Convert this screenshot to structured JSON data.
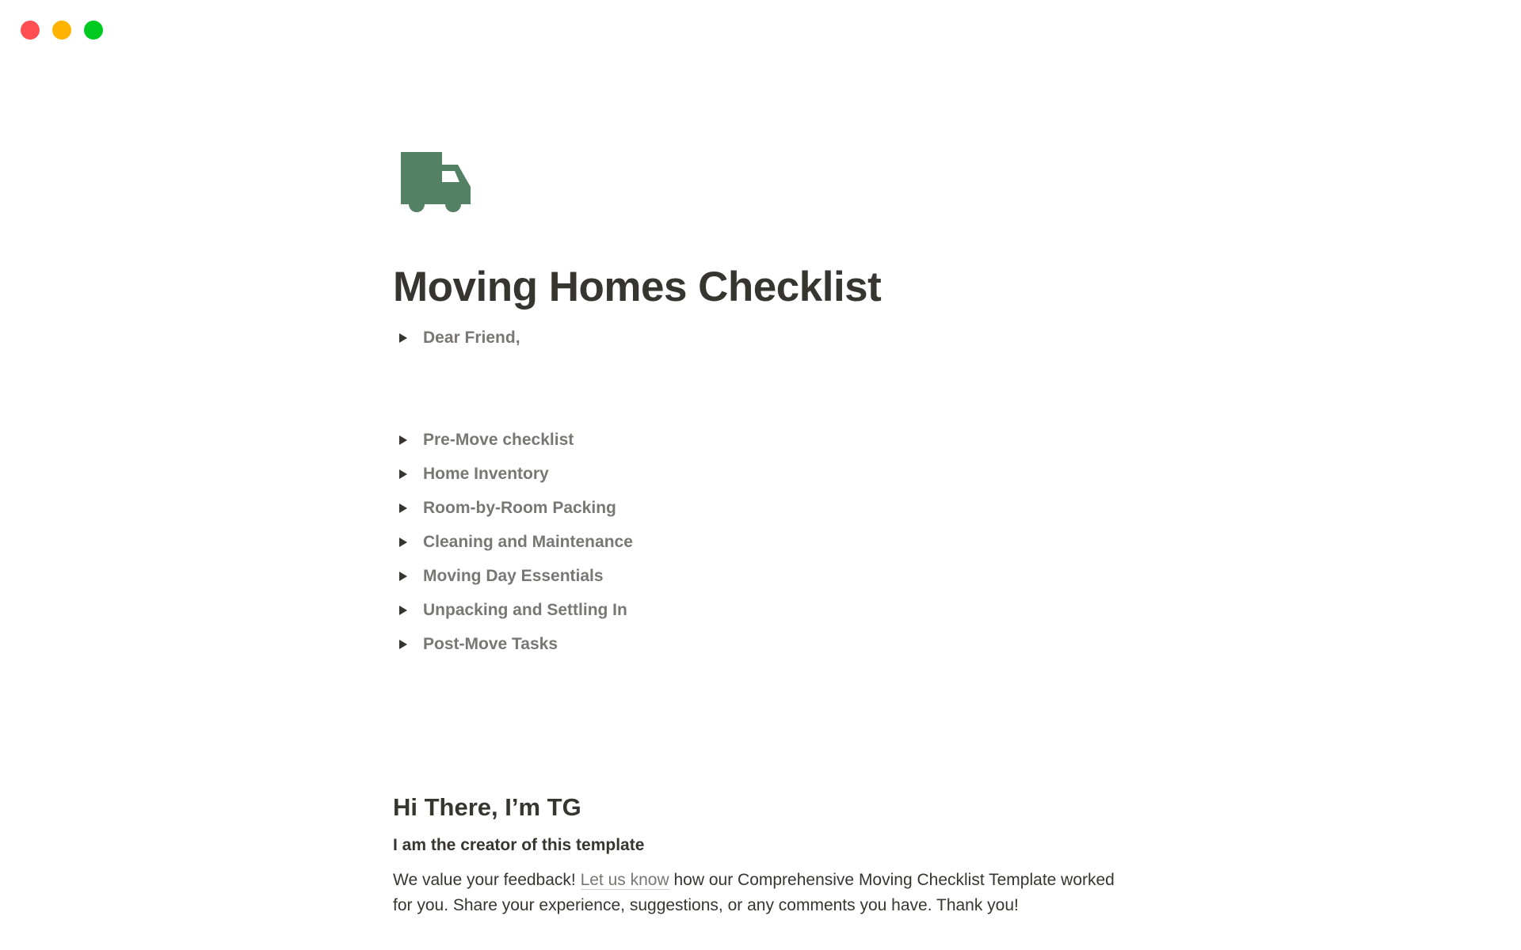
{
  "window": {
    "controls": [
      "close",
      "minimize",
      "zoom"
    ]
  },
  "page": {
    "icon": "truck-icon",
    "icon_color": "#548164",
    "title": "Moving Homes Checklist",
    "intro_toggle": "Dear Friend,",
    "toggles": [
      "Pre-Move checklist",
      "Home Inventory",
      "Room-by-Room Packing",
      "Cleaning and Maintenance",
      "Moving Day Essentials",
      "Unpacking and Settling In",
      "Post-Move Tasks"
    ],
    "creator_heading": "Hi There, I’m TG",
    "creator_subheading": "I am the creator of this template",
    "feedback": {
      "before_link": "We value your feedback! ",
      "link_text": "Let us know",
      "after_link": " how our Comprehensive Moving Checklist Template worked for you. Share your experience, suggestions, or any comments you have. Thank you!"
    }
  }
}
